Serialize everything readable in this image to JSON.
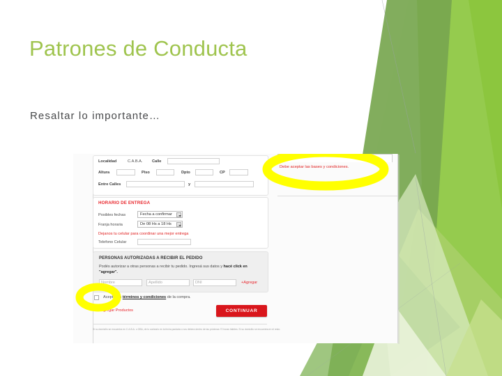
{
  "slide": {
    "title": "Patrones de Conducta",
    "body_text": "Resaltar lo importante…",
    "title_color": "#9FC44E",
    "body_color": "#47484A",
    "accent_greens": [
      "#77A64F",
      "#8CC63E",
      "#A9D06A",
      "#D8E8B8",
      "#EDF4DF"
    ],
    "highlighter_color": "#FFFF00"
  },
  "screenshot": {
    "address_section": {
      "localidad_label": "Localidad",
      "localidad_value": "C.A.B.A.",
      "calle_label": "Calle",
      "altura_label": "Altura",
      "piso_label": "Piso",
      "dpto_label": "Dpto",
      "cp_label": "CP",
      "entre_calles_label": "Entre Calles",
      "entre_calles_join": "y"
    },
    "delivery_section": {
      "heading": "HORARIO DE ENTREGA",
      "posibles_fechas_label": "Posibles fechas",
      "posibles_fechas_value": "Fecha a confirmar",
      "franja_horaria_label": "Franja horaria",
      "franja_horaria_value": "De 08 Hs a 18 Hs",
      "celular_note": "Dejanos tu celular para coordinar una mejor entrega",
      "telefono_label": "Telefono Celular"
    },
    "authorized_section": {
      "heading": "PERSONAS AUTORIZADAS A RECIBIR EL PEDIDO",
      "description_1": "Podés autorizar a otras personas a recibir tu pedido. Ingresá sus datos y ",
      "description_bold": "hacé click en \"agregar\".",
      "nombre_placeholder": "Nombre",
      "apellido_placeholder": "Apellido",
      "dni_placeholder": "DNI",
      "agregar_link": "+Agregar"
    },
    "terms_section": {
      "accept_prefix": "Acepto los ",
      "accept_link": "términos y condiciones",
      "accept_suffix": " de la compra.",
      "agregar_productos_link": "< < Agregar Productos",
      "continuar_button": "CONTINUAR",
      "continuar_color": "#D9161C"
    },
    "validation_callout": {
      "message": "Debe aceptar las bases y condiciones."
    },
    "fineprint": "Si su domicilio se encuentra en C.A.B.A. o GBA, de lo contrario en la fecha pactada o nos debera dentro de las próximas 72 horas hábiles. Si su domicilio se encuentra en el resto"
  }
}
